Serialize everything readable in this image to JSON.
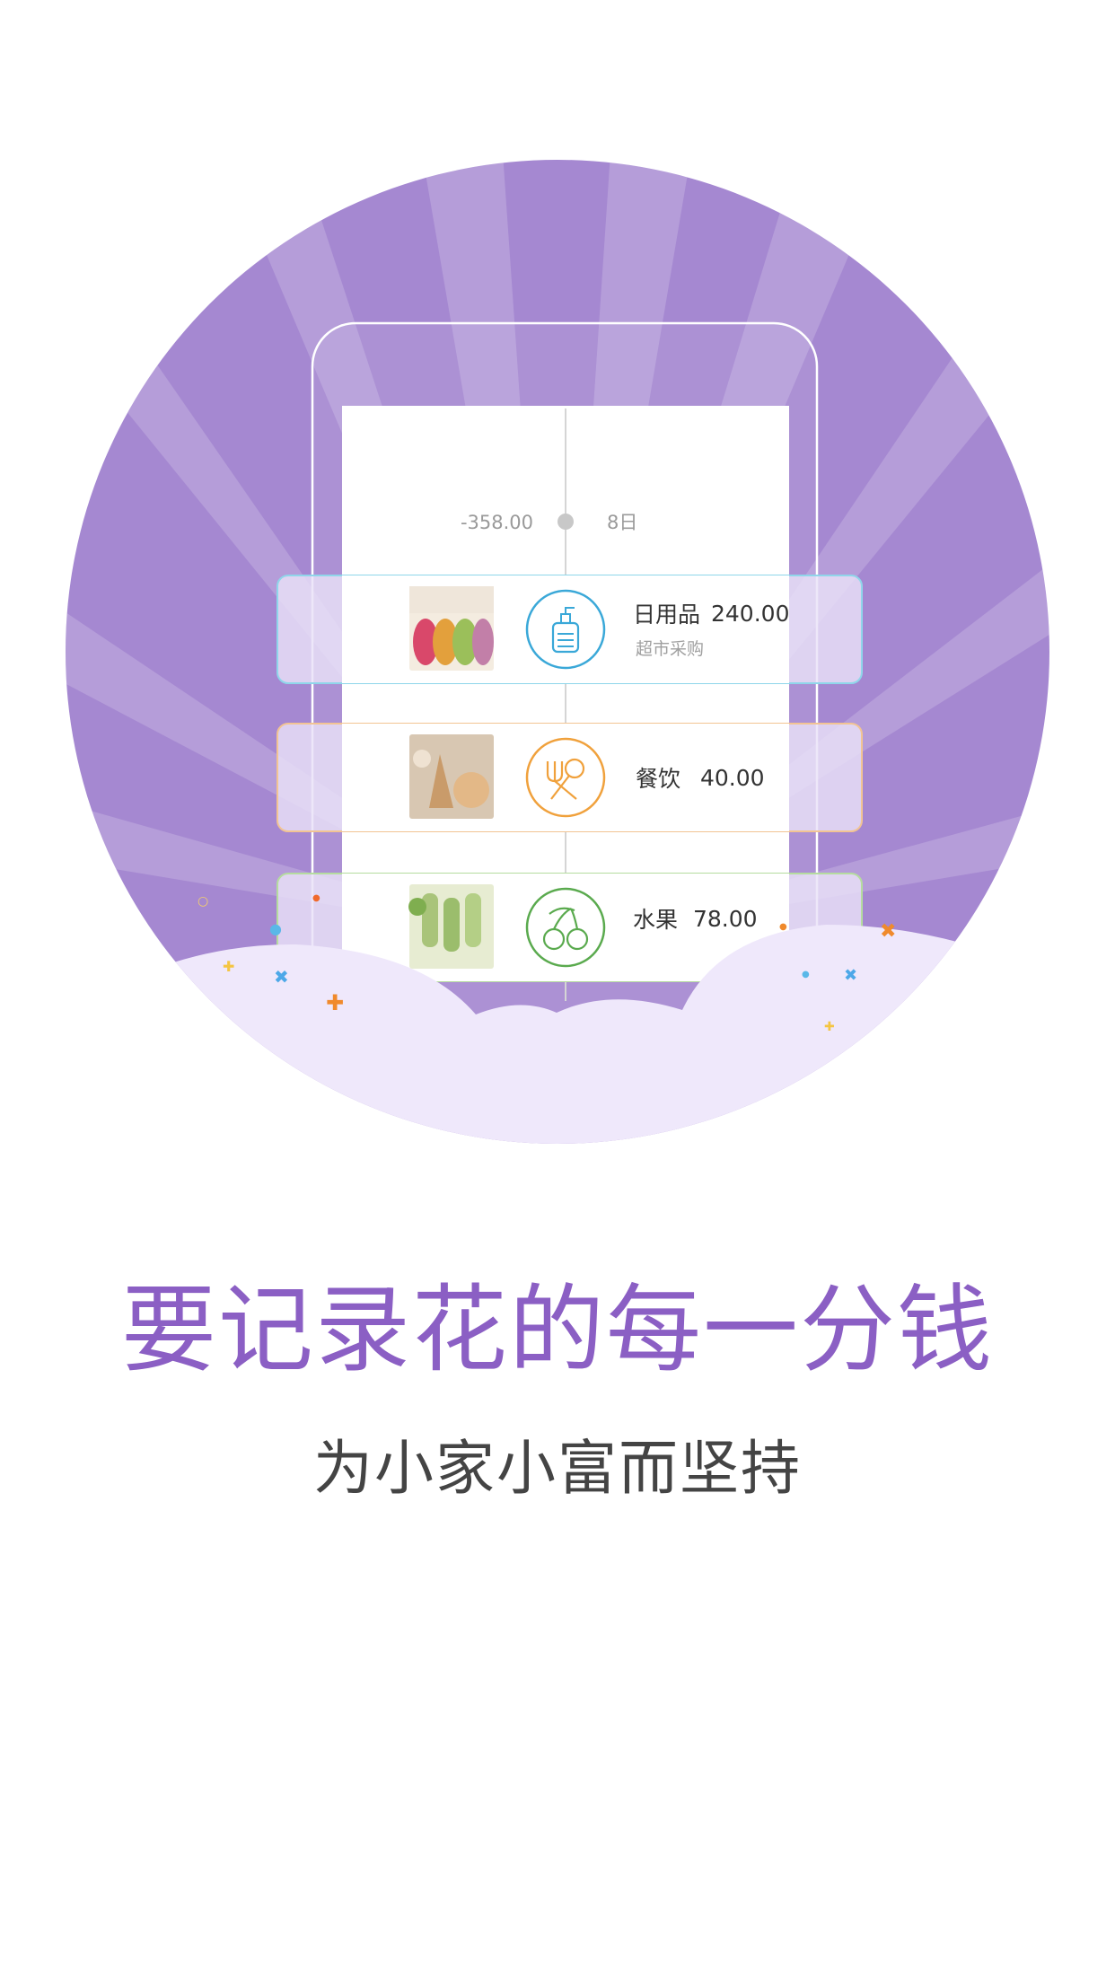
{
  "summary": {
    "amount": "-358.00",
    "day": "8日"
  },
  "entries": [
    {
      "category": "日用品",
      "amount": "240.00",
      "note": "超市采购",
      "icon": "lotion-bottle-icon",
      "color": "#3aa8d8",
      "thumb": "macarons"
    },
    {
      "category": "餐饮",
      "amount": "40.00",
      "icon": "fork-spoon-icon",
      "color": "#f0a13c",
      "thumb": "cookies"
    },
    {
      "category": "水果",
      "amount": "78.00",
      "icon": "cherry-icon",
      "color": "#5aaa4e",
      "thumb": "popsicles"
    }
  ],
  "headline": "要记录花的每一分钱",
  "subline": "为小家小富而坚持",
  "colors": {
    "accent": "#8b5fc4",
    "circle": "#a588d1",
    "cloud": "#efe8fb"
  }
}
